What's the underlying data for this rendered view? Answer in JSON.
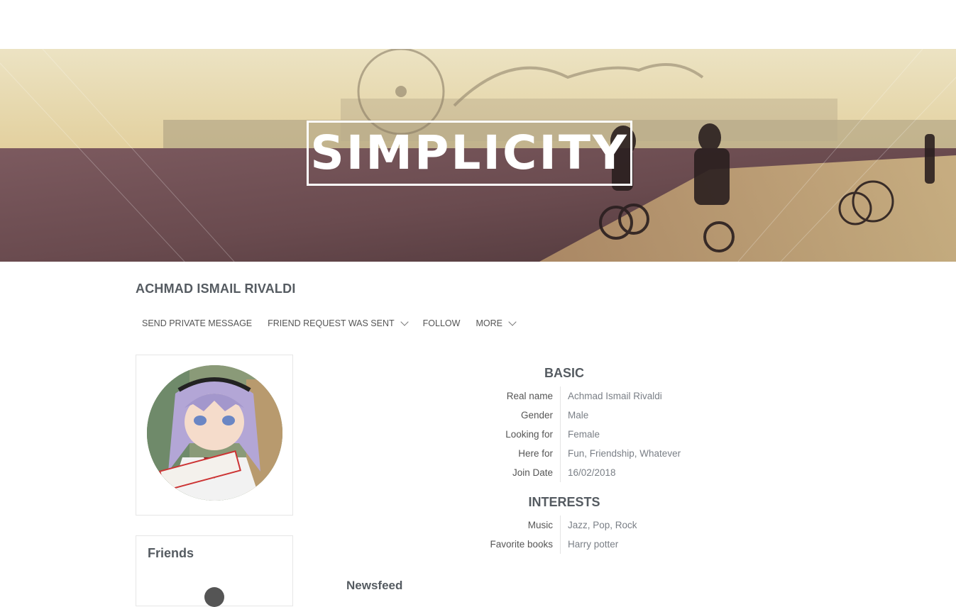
{
  "cover": {
    "title": "SIMPLICITY"
  },
  "profile": {
    "name": "ACHMAD ISMAIL RIVALDI"
  },
  "actions": {
    "send_message": "SEND PRIVATE MESSAGE",
    "friend_request": "FRIEND REQUEST WAS SENT",
    "follow": "FOLLOW",
    "more": "MORE"
  },
  "friends": {
    "title": "Friends"
  },
  "basic": {
    "title": "BASIC",
    "rows": [
      {
        "label": "Real name",
        "value": "Achmad Ismail Rivaldi"
      },
      {
        "label": "Gender",
        "value": "Male"
      },
      {
        "label": "Looking for",
        "value": "Female"
      },
      {
        "label": "Here for",
        "value": "Fun, Friendship, Whatever"
      },
      {
        "label": "Join Date",
        "value": "16/02/2018"
      }
    ]
  },
  "interests": {
    "title": "INTERESTS",
    "rows": [
      {
        "label": "Music",
        "value": "Jazz, Pop, Rock"
      },
      {
        "label": "Favorite books",
        "value": "Harry potter"
      }
    ]
  },
  "newsfeed": {
    "title": "Newsfeed"
  }
}
